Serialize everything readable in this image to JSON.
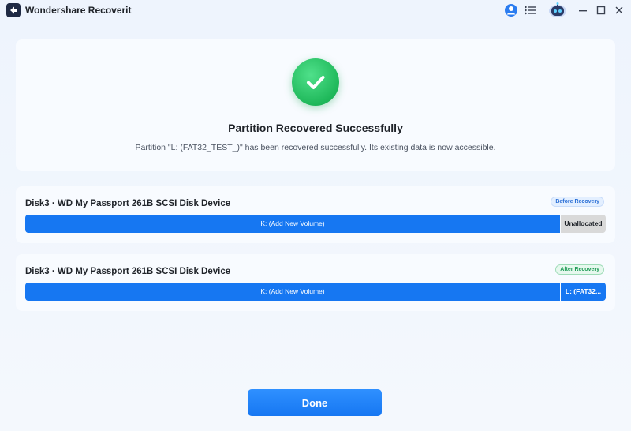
{
  "window": {
    "title": "Wondershare Recoverit"
  },
  "success": {
    "title": "Partition Recovered Successfully",
    "description": "Partition \"L: (FAT32_TEST_)\" has been recovered successfully. Its existing data is now accessible."
  },
  "before": {
    "disk_name": "Disk3 · WD My Passport 261B SCSI Disk Device",
    "badge": "Before Recovery",
    "segments": [
      {
        "label": "K: (Add New Volume)"
      },
      {
        "label": "Unallocated"
      }
    ]
  },
  "after": {
    "disk_name": "Disk3 · WD My Passport 261B SCSI Disk Device",
    "badge": "After Recovery",
    "segments": [
      {
        "label": "K: (Add New Volume)"
      },
      {
        "label": "L: (FAT32..."
      }
    ]
  },
  "actions": {
    "done_label": "Done"
  },
  "colors": {
    "accent": "#1677f2",
    "success": "#1fb85a",
    "unallocated": "#d9d9d9"
  }
}
